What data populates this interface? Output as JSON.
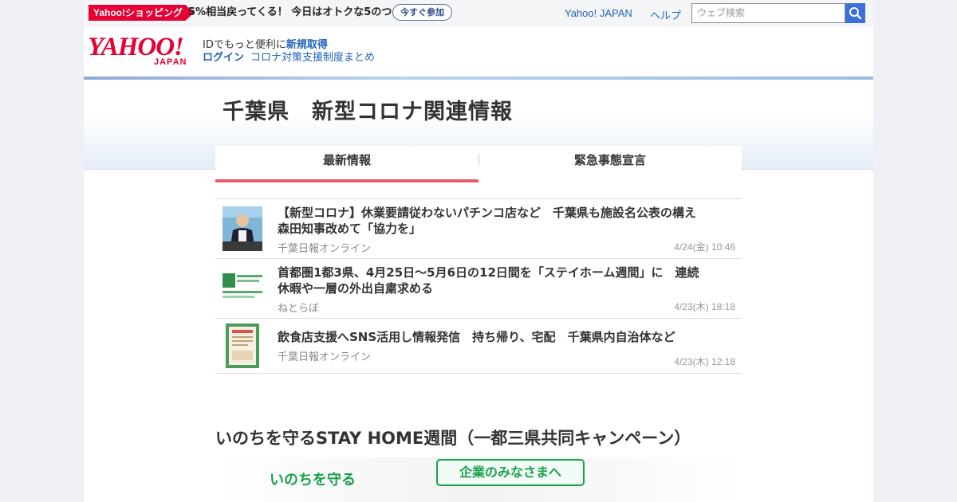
{
  "topbar": {
    "promo_badge": "Yahoo!ショッピング",
    "promo_text": "5%相当戻ってくる！ 今日はオトクな5のつく日",
    "promo_button": "今すぐ参加",
    "links": [
      "Yahoo! JAPAN",
      "ヘルプ"
    ],
    "search_placeholder": "ウェブ検索"
  },
  "header": {
    "logo_main": "YAHOO!",
    "logo_sub": "JAPAN",
    "id_text": "IDでもっと便利に",
    "id_link": "新規取得",
    "login_link": "ログイン",
    "corona_link": "コロナ対策支援制度まとめ"
  },
  "page": {
    "title": "千葉県　新型コロナ関連情報",
    "tabs": [
      "最新情報",
      "緊急事態宣言"
    ]
  },
  "news": [
    {
      "title": "【新型コロナ】休業要請従わないパチンコ店など　千葉県も施設名公表の構え　森田知事改めて「協力を」",
      "source": "千葉日報オンライン",
      "time": "4/24(金) 10:46"
    },
    {
      "title": "首都圏1都3県、4月25日～5月6日の12日間を「ステイホーム週間」に　連続休暇や一層の外出自粛求める",
      "source": "ねとらぼ",
      "time": "4/23(木) 18:18"
    },
    {
      "title": "飲食店支援へSNS活用し情報発信　持ち帰り、宅配　千葉県内自治体など",
      "source": "千葉日報オンライン",
      "time": "4/23(木) 12:18"
    }
  ],
  "campaign": {
    "title": "いのちを守るSTAY HOME週間（一都三県共同キャンペーン）",
    "banner_text": "いのちを守る",
    "banner_button": "企業のみなさまへ"
  },
  "colors": {
    "brand_red": "#e60033",
    "link_blue": "#2062b8",
    "tab_accent": "#e85b6e",
    "campaign_green": "#19a14a"
  }
}
